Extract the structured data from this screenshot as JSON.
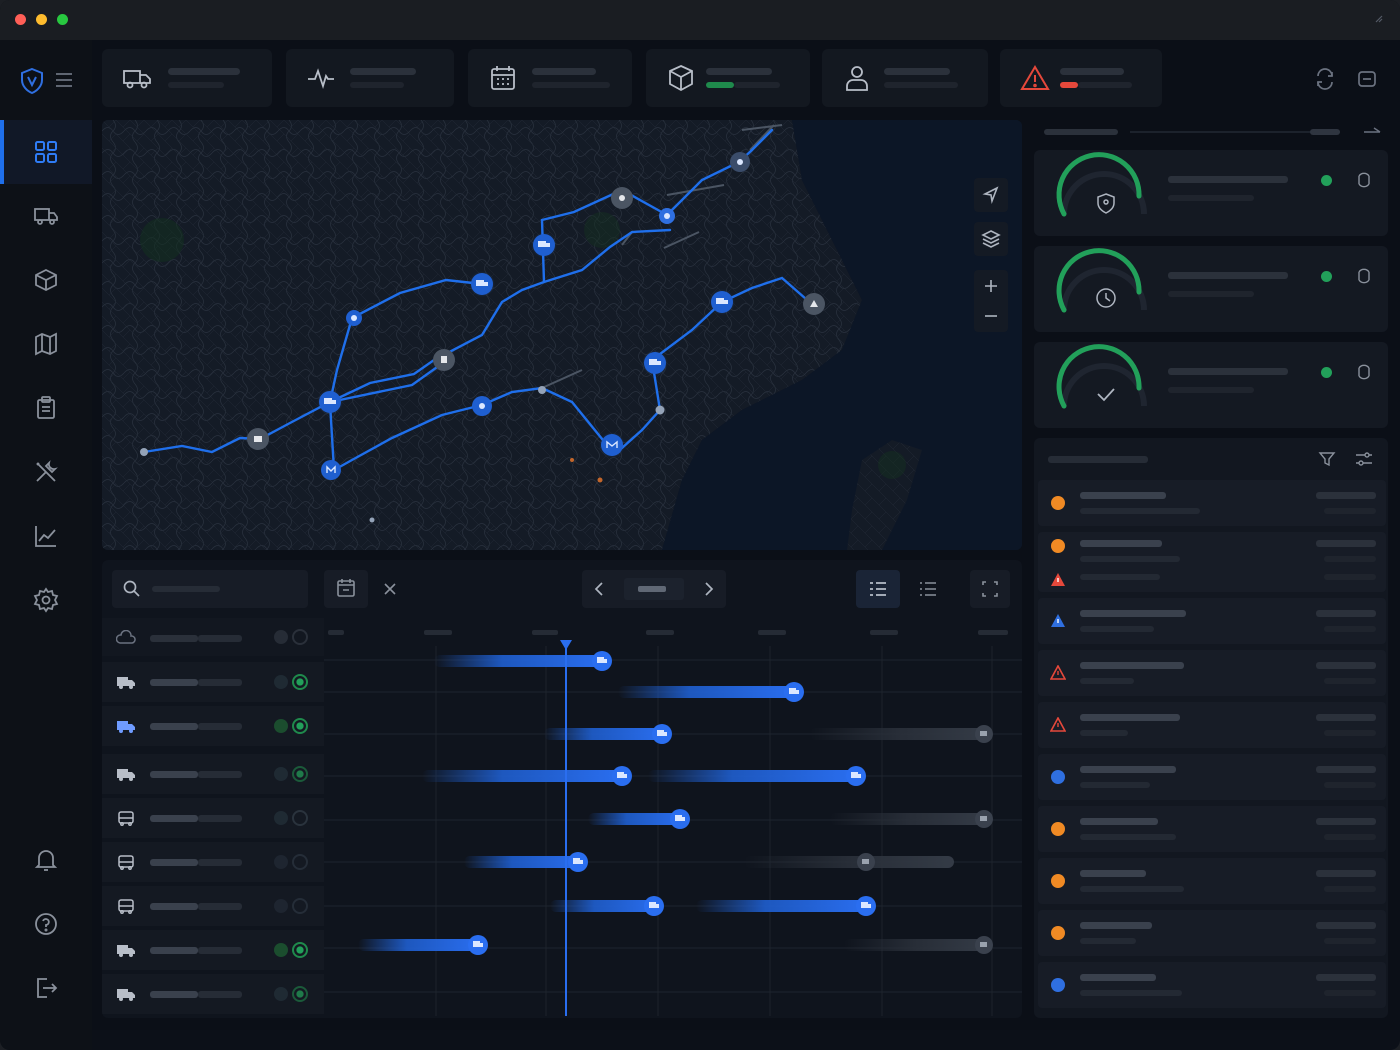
{
  "window": {
    "controls": [
      "close",
      "minimize",
      "maximize"
    ],
    "colors": {
      "close": "#ff5f57",
      "minimize": "#febc2e",
      "maximize": "#28c840"
    }
  },
  "sidebar": {
    "logo": "shield-logo-icon",
    "items": [
      {
        "icon": "dashboard-grid-icon",
        "active": true
      },
      {
        "icon": "truck-icon",
        "active": false
      },
      {
        "icon": "box-icon",
        "active": false
      },
      {
        "icon": "map-icon",
        "active": false
      },
      {
        "icon": "clipboard-icon",
        "active": false
      },
      {
        "icon": "tools-icon",
        "active": false
      },
      {
        "icon": "analytics-chart-icon",
        "active": false
      },
      {
        "icon": "settings-gear-icon",
        "active": false
      }
    ],
    "bottom": [
      {
        "icon": "bell-icon"
      },
      {
        "icon": "help-icon"
      },
      {
        "icon": "logout-icon"
      }
    ]
  },
  "kpis": [
    {
      "icon": "truck-icon",
      "accent": "#2b313b"
    },
    {
      "icon": "activity-pulse-icon",
      "accent": "#2b313b"
    },
    {
      "icon": "calendar-icon",
      "accent": "#2b313b"
    },
    {
      "icon": "package-icon",
      "accent": "#1f8a4c"
    },
    {
      "icon": "driver-user-icon",
      "accent": "#2b313b"
    },
    {
      "icon": "warning-triangle-icon",
      "accent": "#e5483b"
    }
  ],
  "header_actions": [
    "sync-icon",
    "refresh-icon"
  ],
  "map": {
    "controls": [
      "locate-icon",
      "layers-icon",
      "zoom-in-icon",
      "zoom-out-icon"
    ],
    "marker_count": 18
  },
  "gantt": {
    "toolbar": [
      "search-icon",
      "calendar-icon",
      "clear-icon",
      "prev-icon",
      "next-icon",
      "view-detailed-icon",
      "view-list-icon",
      "fullscreen-icon"
    ],
    "rows": [
      {
        "icon": "cloud-truck-icon",
        "status": "inactive"
      },
      {
        "icon": "truck-icon",
        "status": "active"
      },
      {
        "icon": "truck-icon",
        "status": "active-highlight"
      },
      {
        "icon": "truck-icon",
        "status": "active"
      },
      {
        "icon": "bus-icon",
        "status": "inactive"
      },
      {
        "icon": "bus-icon",
        "status": "inactive"
      },
      {
        "icon": "bus-icon",
        "status": "inactive"
      },
      {
        "icon": "truck-icon",
        "status": "active-highlight"
      },
      {
        "icon": "truck-icon",
        "status": "active"
      }
    ]
  },
  "gauges": [
    {
      "icon": "shield-icon",
      "level": 0.85,
      "status_color": "#22a05a"
    },
    {
      "icon": "clock-icon",
      "level": 0.85,
      "status_color": "#22a05a"
    },
    {
      "icon": "check-icon",
      "level": 0.85,
      "status_color": "#22a05a"
    }
  ],
  "alerts": {
    "toolbar": [
      "filter-icon",
      "settings-sliders-icon"
    ],
    "items": [
      {
        "icon": "orange-dot-icon",
        "color": "#f08a24"
      },
      {
        "icon": "orange-dot-icon",
        "color": "#f08a24"
      },
      {
        "icon": "red-triangle-icon",
        "color": "#e5483b"
      },
      {
        "icon": "blue-triangle-icon",
        "color": "#2f6fe0"
      },
      {
        "icon": "red-triangle-icon",
        "color": "#e5483b"
      },
      {
        "icon": "red-triangle-icon",
        "color": "#e5483b"
      },
      {
        "icon": "blue-dot-icon",
        "color": "#2f6fe0"
      },
      {
        "icon": "orange-dot-icon",
        "color": "#f08a24"
      },
      {
        "icon": "orange-dot-icon",
        "color": "#f08a24"
      },
      {
        "icon": "orange-dot-icon",
        "color": "#f08a24"
      },
      {
        "icon": "blue-dot-icon",
        "color": "#2f6fe0"
      }
    ]
  }
}
